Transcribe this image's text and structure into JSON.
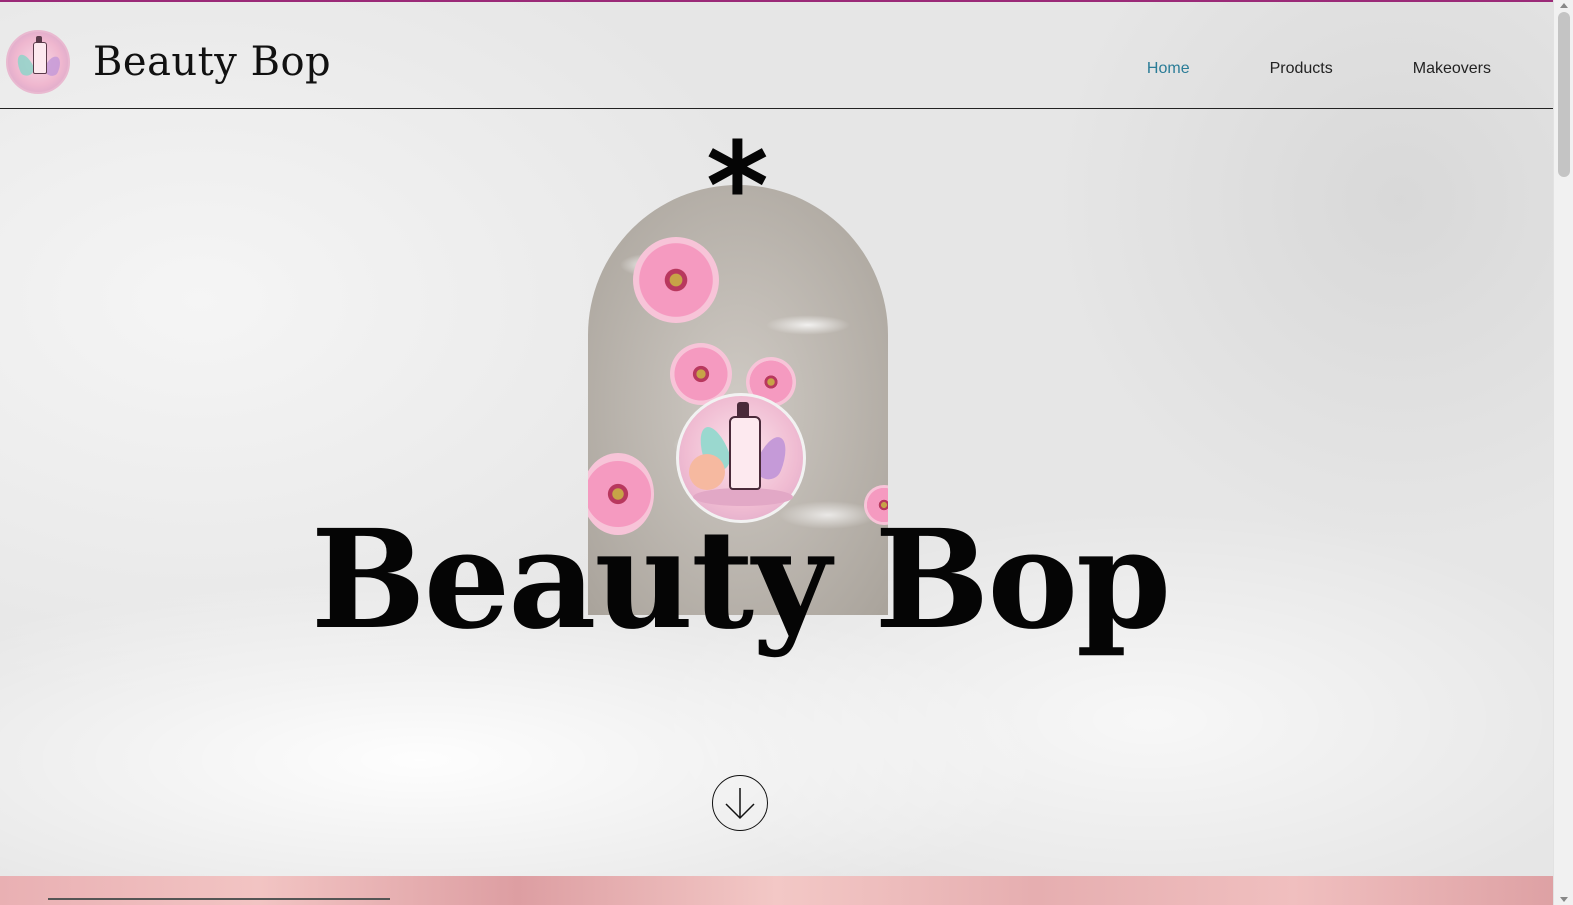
{
  "header": {
    "site_title": "Beauty Bop",
    "nav": [
      {
        "label": "Home",
        "active": true
      },
      {
        "label": "Products",
        "active": false
      },
      {
        "label": "Makeovers",
        "active": false
      }
    ]
  },
  "hero": {
    "asterisk": "*",
    "title": "Beauty Bop",
    "scroll_button_icon": "arrow-down-circle-icon"
  },
  "colors": {
    "accent_top": "#9b2a78",
    "nav_active": "#2a7c97",
    "text_dark": "#050505",
    "bottom_band": "#e9b0b3"
  }
}
